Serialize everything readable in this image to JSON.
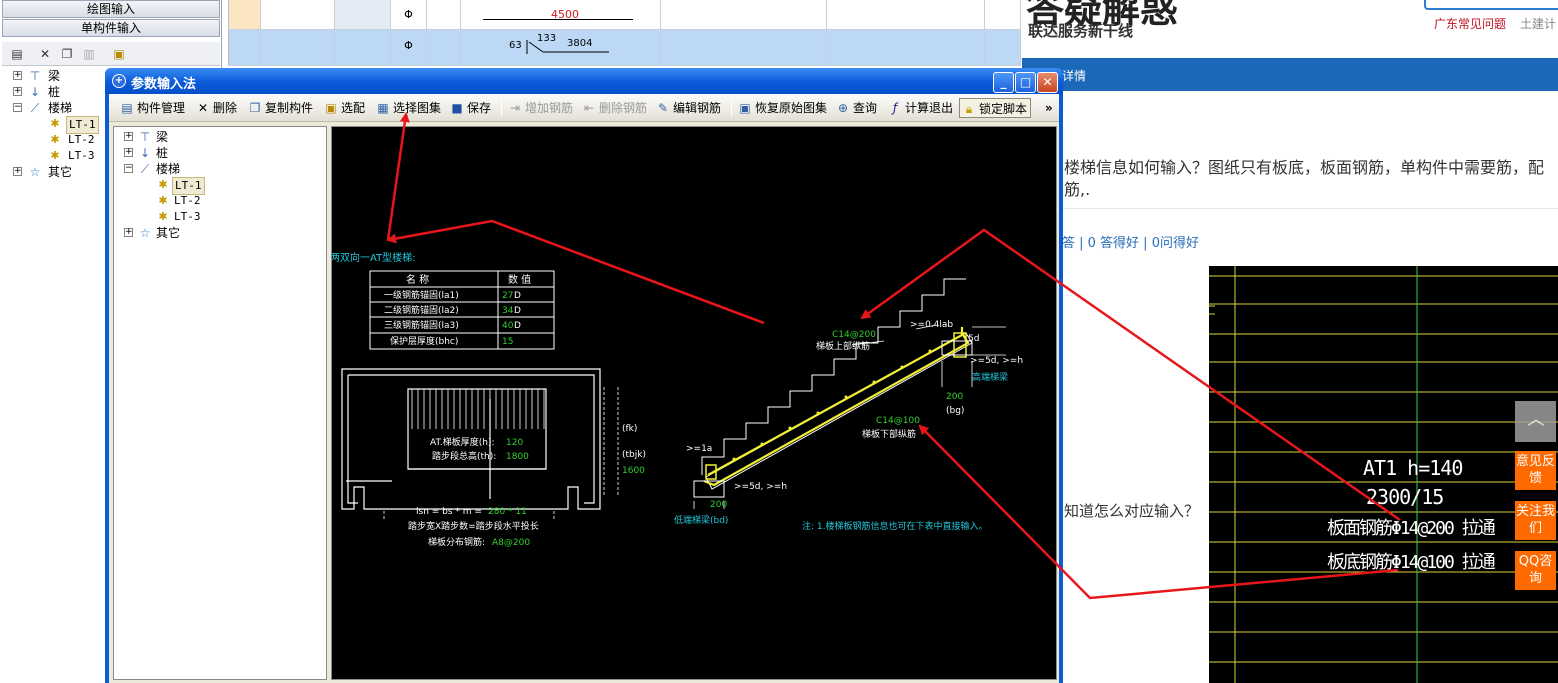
{
  "left_nav": {
    "btn_drawing_input": "绘图输入",
    "btn_single_input": "单构件输入",
    "tree": [
      {
        "label": "梁"
      },
      {
        "label": "桩"
      },
      {
        "label": "楼梯"
      },
      {
        "label": "LT-1"
      },
      {
        "label": "LT-2"
      },
      {
        "label": "LT-3"
      },
      {
        "label": "其它"
      }
    ]
  },
  "grid": {
    "row1": {
      "symbol": "Φ",
      "dim": "4500"
    },
    "row2": {
      "symbol": "Φ",
      "dim_a": "63",
      "dim_b": "133",
      "dim_c": "3804"
    }
  },
  "dialog": {
    "title": "参数输入法",
    "toolbar": {
      "component_mgmt": "构件管理",
      "delete": "删除",
      "copy_component": "复制构件",
      "select_match": "选配",
      "select_atlas": "选择图集",
      "save": "保存",
      "add_rebar": "增加钢筋",
      "delete_rebar": "删除钢筋",
      "edit_rebar": "编辑钢筋",
      "restore_atlas": "恢复原始图集",
      "query": "查询",
      "calc_exit": "计算退出",
      "lock_script": "锁定脚本",
      "more": "»"
    },
    "tree": [
      {
        "label": "梁"
      },
      {
        "label": "桩"
      },
      {
        "label": "楼梯"
      },
      {
        "label": "LT-1"
      },
      {
        "label": "LT-2"
      },
      {
        "label": "LT-3"
      },
      {
        "label": "其它"
      }
    ],
    "cad": {
      "heading": "两双向一AT型楼梯:",
      "table_header_name": "名 称",
      "table_header_value": "数 值",
      "rows": [
        {
          "name": "一级钢筋锚固(la1)",
          "value": "27",
          "unit": "D"
        },
        {
          "name": "二级钢筋锚固(la2)",
          "value": "34",
          "unit": "D"
        },
        {
          "name": "三级钢筋锚固(la3)",
          "value": "40",
          "unit": "D"
        },
        {
          "name": "保护层厚度(bhc)",
          "value": "15",
          "unit": ""
        }
      ],
      "plan_thick_label": "AT.梯板厚度(h):",
      "plan_thick_value": "120",
      "plan_height_label": "踏步段总高(th):",
      "plan_height_value": "1800",
      "plan_fk": "(fk)",
      "plan_tbjk": "(tbjk)",
      "plan_1600": "1600",
      "formula_lsn": "lsn = bs * m =",
      "formula_val": "280 * 11",
      "formula_note": "踏步宽X踏步数=踏步段水平投长",
      "dist_label": "梯板分布钢筋:",
      "dist_value": "A8@200",
      "top_bar_code": "C14@200",
      "top_bar_label": "梯板上部纵筋",
      "bot_bar_code": "C14@100",
      "bot_bar_label": "梯板下部纵筋",
      "dim_04lab": ">=0.4lab",
      "dim_5d": "5d",
      "dim_5d_h": ">=5d, >=h",
      "dim_5d_h2": ">=5d, >=h",
      "dim_high_beam": "高端梯梁",
      "dim_200_a": "200",
      "dim_bg": "(bg)",
      "dim_1a": ">=1a",
      "dim_200_b": "200",
      "low_beam": "低端梯梁(bd)",
      "note": "注: 1.楼梯板钢筋信息也可在下表中直接输入。"
    }
  },
  "web": {
    "logo": "答疑解惑",
    "slogan": "联达服务新干线",
    "link_faq": "广东常见问题",
    "link_civil": "土建计",
    "bar_text": "详情",
    "question": "楼梯信息如何输入？图纸只有板底，板面钢筋，单构件中需要筋，配筋,.",
    "stats": "答 | 0 答得好 | 0问得好",
    "answer_text": "知道怎么对应输入？",
    "img_line1": "AT1 h=140",
    "img_line2": "2300/15",
    "img_line3": "板面钢筋Φ14@200 拉通",
    "img_line4": "板底钢筋Φ14@100 拉通",
    "side_feedback": "意见反馈",
    "side_follow": "关注我们",
    "side_qq": "QQ咨询"
  },
  "colors": {
    "dialog_blue": "#0b5bd6",
    "cad_green": "#2fd02f",
    "cad_cyan": "#22c6d8",
    "cad_yellow": "#f2ef34",
    "annotation_red": "#e8161b",
    "side_orange": "#ff6a00"
  }
}
